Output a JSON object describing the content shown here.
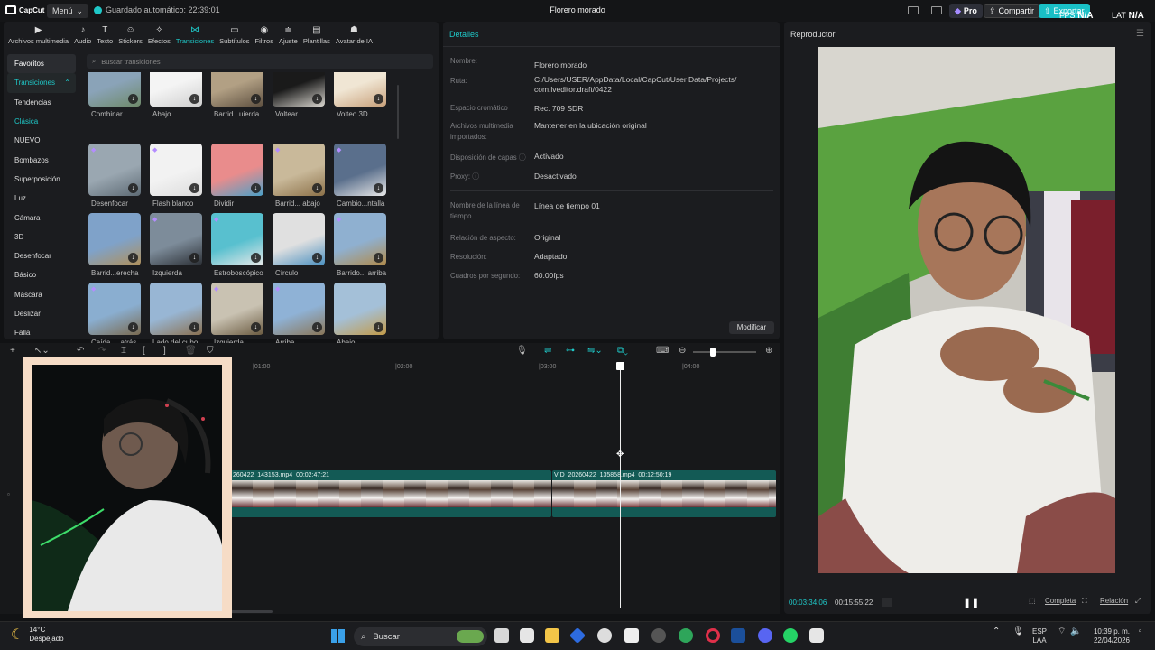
{
  "app": {
    "logo": "CapCut",
    "menu_label": "Menú",
    "autosave": "Guardado automático: 22:39:01",
    "project_title": "Florero morado",
    "pro_label": "Pro",
    "share_label": "Compartir",
    "export_label": "Exportar",
    "fps_label": "FPS",
    "fps_value": "N/A",
    "lat_label": "LAT",
    "lat_value": "N/A"
  },
  "tabs": [
    {
      "icon": "▶",
      "label": "Archivos multimedia"
    },
    {
      "icon": "♪",
      "label": "Audio"
    },
    {
      "icon": "T",
      "label": "Texto"
    },
    {
      "icon": "☺",
      "label": "Stickers"
    },
    {
      "icon": "✧",
      "label": "Efectos"
    },
    {
      "icon": "⋈",
      "label": "Transiciones"
    },
    {
      "icon": "▭",
      "label": "Subtítulos"
    },
    {
      "icon": "◉",
      "label": "Filtros"
    },
    {
      "icon": "≑",
      "label": "Ajuste"
    },
    {
      "icon": "▤",
      "label": "Plantillas"
    },
    {
      "icon": "☗",
      "label": "Avatar de IA"
    }
  ],
  "categories": [
    "Favoritos",
    "Transiciones",
    "Tendencias",
    "Clásica",
    "NUEVO",
    "Bombazos",
    "Superposición",
    "Luz",
    "Cámara",
    "3D",
    "Desenfocar",
    "Básico",
    "Máscara",
    "Deslizar",
    "Falla"
  ],
  "search_placeholder": "Buscar transiciones",
  "thumbs": [
    {
      "label": "Combinar",
      "c1": "#8aa3b8",
      "c2": "#6f8a6a"
    },
    {
      "label": "Abajo",
      "c1": "#f4f4f4",
      "c2": "#cfcfcf"
    },
    {
      "label": "Barrid...uierda",
      "c1": "#b2a084",
      "c2": "#5e5040"
    },
    {
      "label": "Voltear",
      "c1": "#1a1a1a",
      "c2": "#d9d6cf"
    },
    {
      "label": "Volteo 3D",
      "c1": "#f0e6d4",
      "c2": "#c8a07a"
    },
    {
      "label": "Desenfocar",
      "c1": "#9aa7b1",
      "c2": "#5d6a74"
    },
    {
      "label": "Flash blanco",
      "c1": "#f2f2f2",
      "c2": "#dcdcdc"
    },
    {
      "label": "Dividir",
      "c1": "#e98c8c",
      "c2": "#4aa0c8"
    },
    {
      "label": "Barrid... abajo",
      "c1": "#c9b99a",
      "c2": "#8b7048"
    },
    {
      "label": "Cambio...ntalla",
      "c1": "#5a6f8c",
      "c2": "#e8e8e8"
    },
    {
      "label": "Barrid...erecha",
      "c1": "#7fa2c9",
      "c2": "#b0905a"
    },
    {
      "label": "Izquierda",
      "c1": "#7d8c9a",
      "c2": "#2b2f35"
    },
    {
      "label": "Estroboscópico",
      "c1": "#58c0cf",
      "c2": "#e8e8e8"
    },
    {
      "label": "Círculo",
      "c1": "#e0e0e0",
      "c2": "#4a90c0"
    },
    {
      "label": "Barrido... arriba",
      "c1": "#8fb0d0",
      "c2": "#b08a4a"
    },
    {
      "label": "Caída ... atrás",
      "c1": "#8aaed0",
      "c2": "#7a6a50"
    },
    {
      "label": "Lado del cubo",
      "c1": "#98b6d4",
      "c2": "#8a7050"
    },
    {
      "label": "Izquierda",
      "c1": "#c9c2b2",
      "c2": "#6a5a40"
    },
    {
      "label": "Arriba",
      "c1": "#8fb2d6",
      "c2": "#8a7658"
    },
    {
      "label": "Abajo",
      "c1": "#a4c0d8",
      "c2": "#c29a48"
    }
  ],
  "details": {
    "title": "Detalles",
    "rows": [
      {
        "k": "Nombre:",
        "v": "Florero morado"
      },
      {
        "k": "Ruta:",
        "v": "C:/Users/USER/AppData/Local/CapCut/User Data/Projects/ com.lveditor.draft/0422"
      },
      {
        "k": "Espacio cromático",
        "v": "Rec. 709 SDR"
      },
      {
        "k": "Archivos multimedia importados:",
        "v": "Mantener en la ubicación original"
      },
      {
        "k": "Disposición de capas ⓘ",
        "v": "Activado"
      },
      {
        "k": "Proxy: ⓘ",
        "v": "Desactivado"
      },
      {
        "k": "Nombre de la línea de tiempo",
        "v": "Línea de tiempo 01"
      },
      {
        "k": "Relación de aspecto:",
        "v": "Original"
      },
      {
        "k": "Resolución:",
        "v": "Adaptado"
      },
      {
        "k": "Cuadros por segundo:",
        "v": "60.00fps"
      }
    ],
    "modify_label": "Modificar"
  },
  "player": {
    "title": "Reproductor",
    "current_time": "00:03:34:06",
    "total_time": "00:15:55:22",
    "full_label": "Completa",
    "ratio_label": "Relación"
  },
  "timeline": {
    "ticks": [
      "|01:00",
      "|02:00",
      "|03:00",
      "|04:00"
    ],
    "clips": [
      {
        "label": "260422_143153.mp4",
        "duration": "00:02:47:21"
      },
      {
        "label": "VID_20260422_135858.mp4",
        "duration": "00:12:50:19"
      }
    ]
  },
  "taskbar": {
    "temp": "14°C",
    "weather": "Despejado",
    "search": "Buscar",
    "lang1": "ESP",
    "lang2": "LAA",
    "time": "10:39 p. m.",
    "date": "22/04/2026"
  }
}
